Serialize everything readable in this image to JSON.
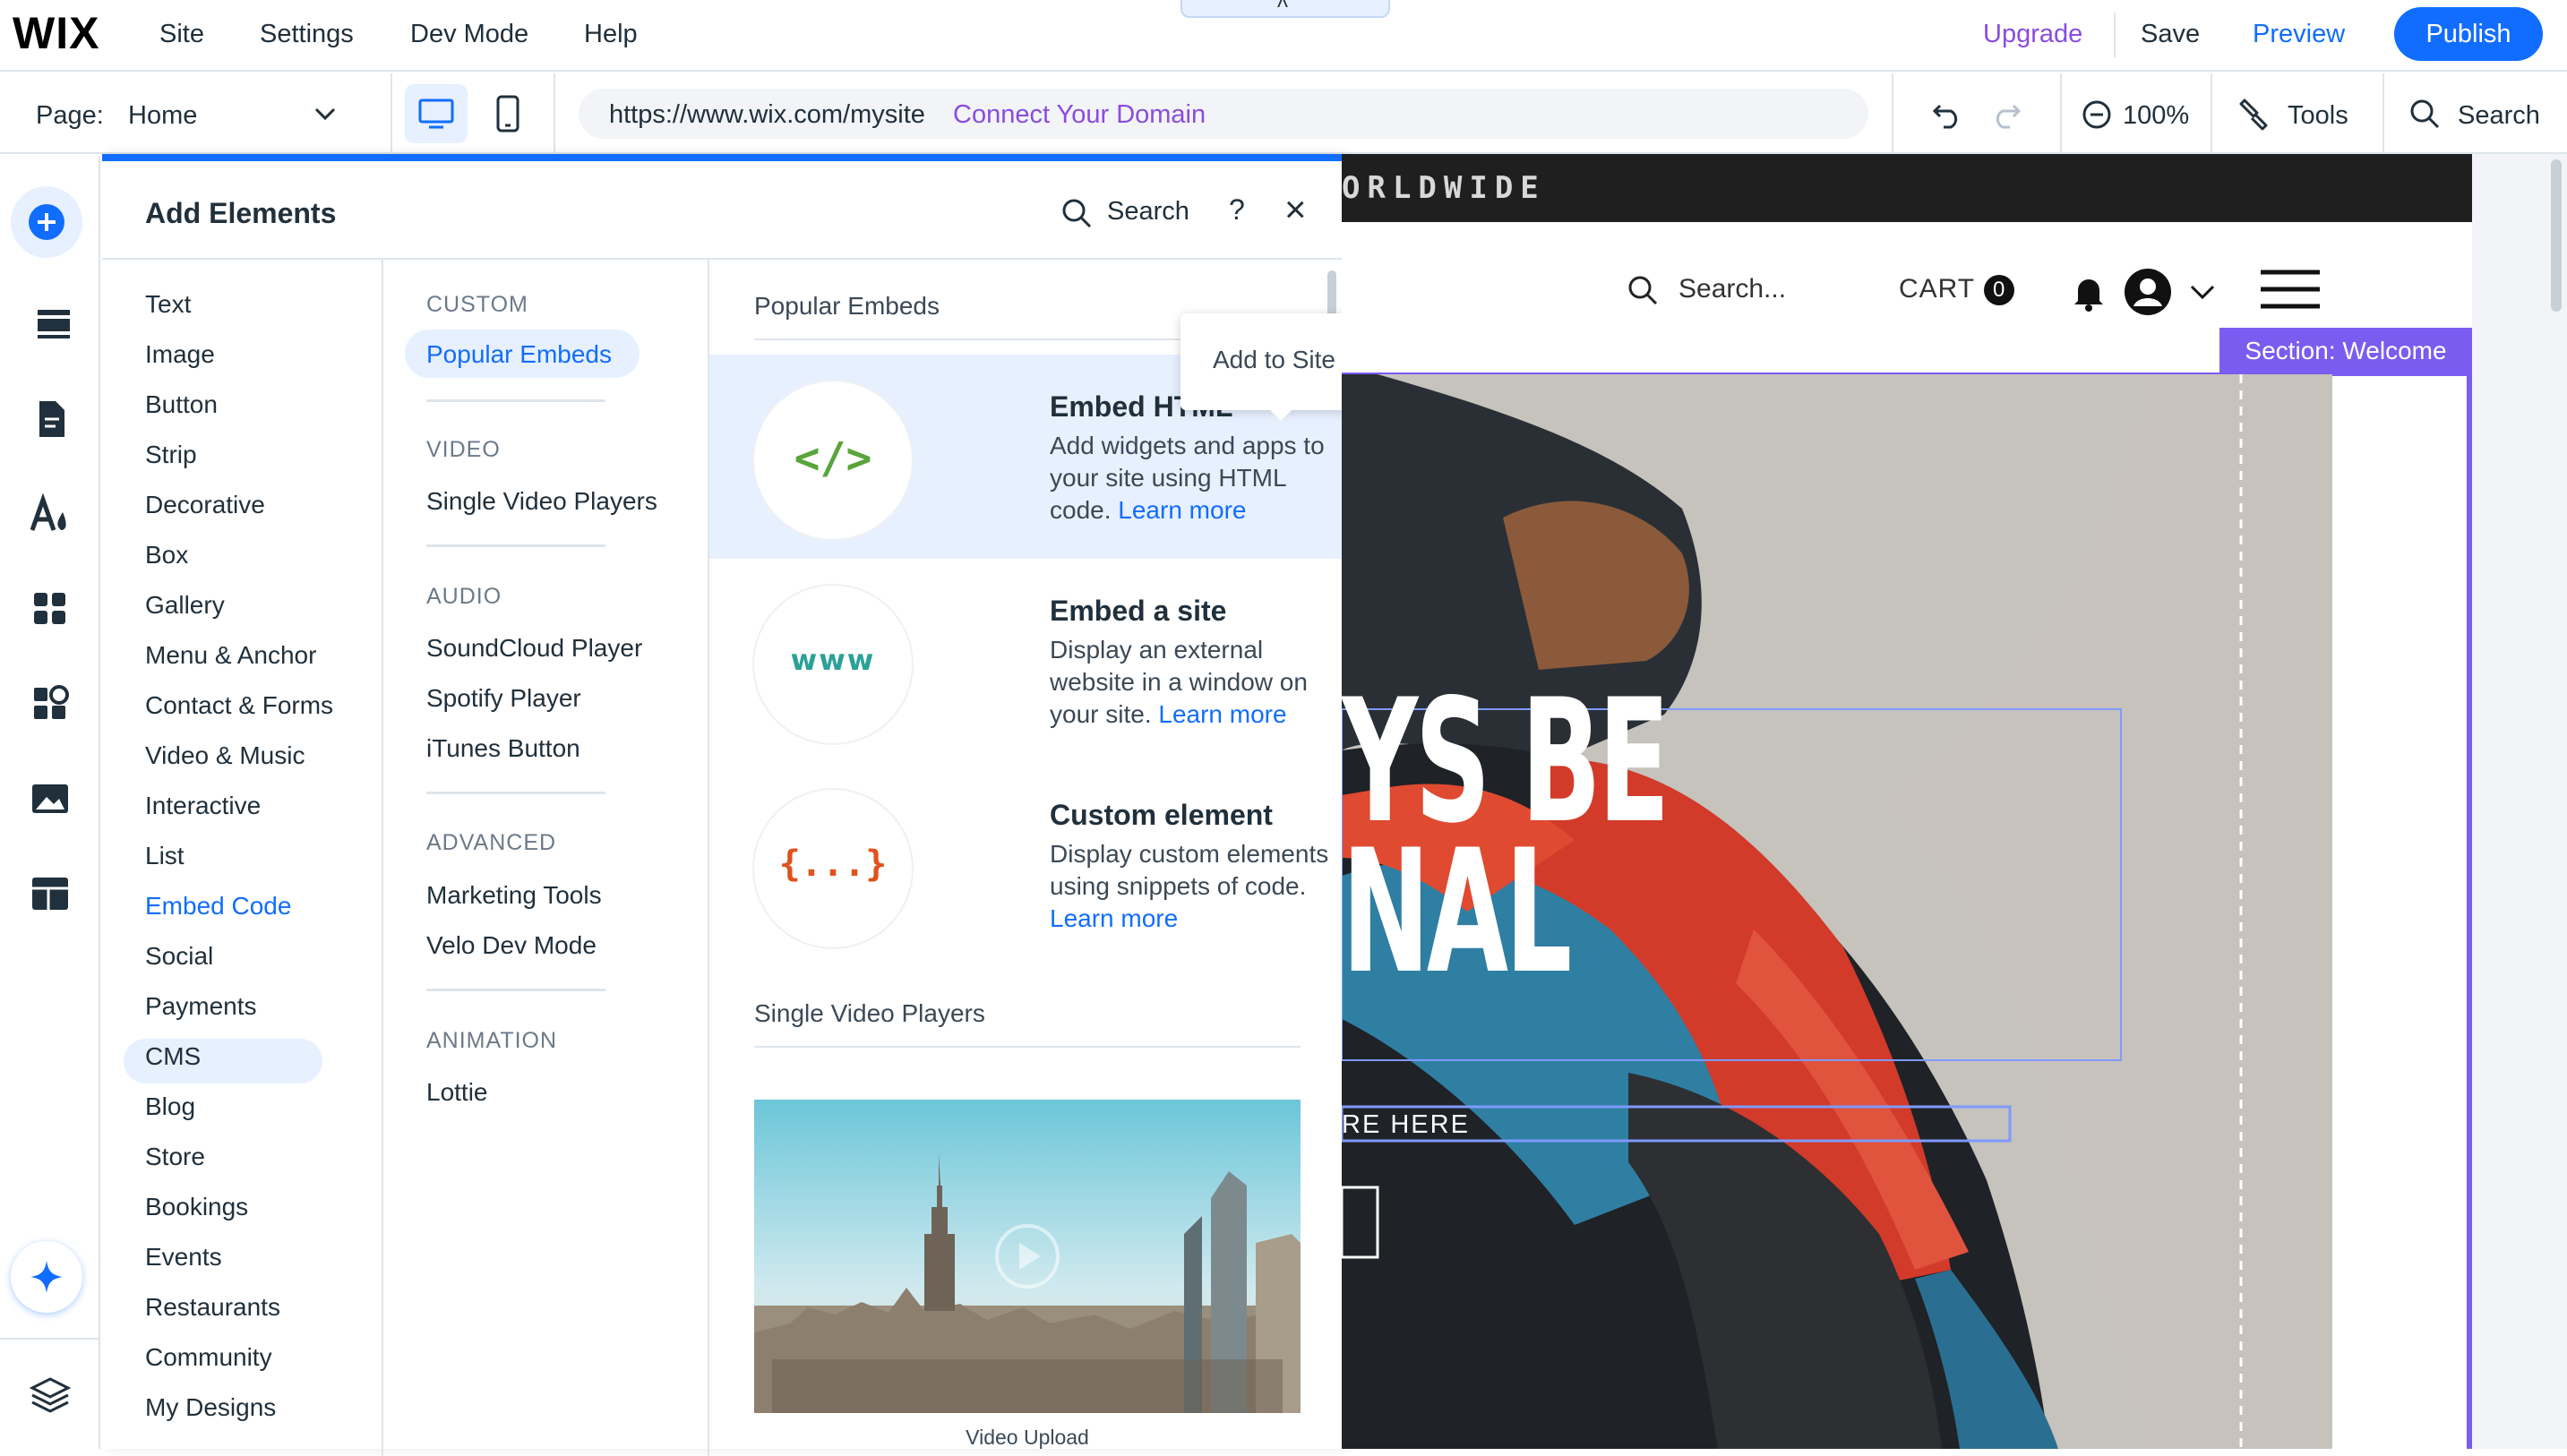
{
  "app": {
    "logo": "WIX",
    "menu": [
      "Site",
      "Settings",
      "Dev Mode",
      "Help"
    ],
    "top_tab_glyph": "˄",
    "upgrade": "Upgrade",
    "save": "Save",
    "preview": "Preview",
    "publish": "Publish",
    "accent_color": "#116dff"
  },
  "toolbar": {
    "page_label": "Page:",
    "page_value": "Home",
    "url": "https://www.wix.com/mysite",
    "connect_domain": "Connect Your Domain",
    "zoom": "100%",
    "tools": "Tools",
    "search": "Search"
  },
  "rail": {
    "icons": [
      "add-elements-icon",
      "sections-icon",
      "pages-icon",
      "design-icon",
      "apps-icon",
      "business-apps-icon",
      "media-icon",
      "cms-icon",
      "ai-assistant-icon",
      "layers-icon"
    ]
  },
  "panel": {
    "title": "Add Elements",
    "search": "Search",
    "help": "?",
    "close": "×",
    "categories": [
      "Text",
      "Image",
      "Button",
      "Strip",
      "Decorative",
      "Box",
      "Gallery",
      "Menu & Anchor",
      "Contact & Forms",
      "Video & Music",
      "Interactive",
      "List",
      "Embed Code",
      "Social",
      "Payments",
      "CMS",
      "Blog",
      "Store",
      "Bookings",
      "Events",
      "Restaurants",
      "Community",
      "My Designs"
    ],
    "active_category": "Embed Code",
    "subgroups": [
      {
        "heading": "CUSTOM",
        "items": [
          "Popular Embeds"
        ]
      },
      {
        "heading": "VIDEO",
        "items": [
          "Single Video Players"
        ]
      },
      {
        "heading": "AUDIO",
        "items": [
          "SoundCloud Player",
          "Spotify Player",
          "iTunes Button"
        ]
      },
      {
        "heading": "ADVANCED",
        "items": [
          "Marketing Tools",
          "Velo Dev Mode"
        ]
      },
      {
        "heading": "ANIMATION",
        "items": [
          "Lottie"
        ]
      }
    ],
    "active_subgroup": "Popular Embeds",
    "section1_title": "Popular Embeds",
    "section2_title": "Single Video Players",
    "tooltip": "Add to Site",
    "embeds": [
      {
        "icon_text": "</>",
        "title": "Embed HTML",
        "desc": "Add widgets and apps to your site using HTML code.",
        "learn": "Learn more",
        "color": "#5aa43c"
      },
      {
        "icon_text": "www",
        "title": "Embed a site",
        "desc": "Display an external website in a window on your site.",
        "learn": "Learn more",
        "color": "#2aa198"
      },
      {
        "icon_text": "{...}",
        "title": "Custom element",
        "desc": "Display custom elements using snippets of code.",
        "learn": "Learn more",
        "color": "#e0531c"
      }
    ],
    "video_caption": "Video Upload"
  },
  "canvas": {
    "banner_text": "ORLDWIDE",
    "search_placeholder": "Search...",
    "cart_label": "CART",
    "cart_count": "0",
    "section_label": "Section: Welcome",
    "headline_line1": "YS BE",
    "headline_line2": "NAL",
    "subline": "RE HERE",
    "section_color": "#7b5cf0"
  }
}
